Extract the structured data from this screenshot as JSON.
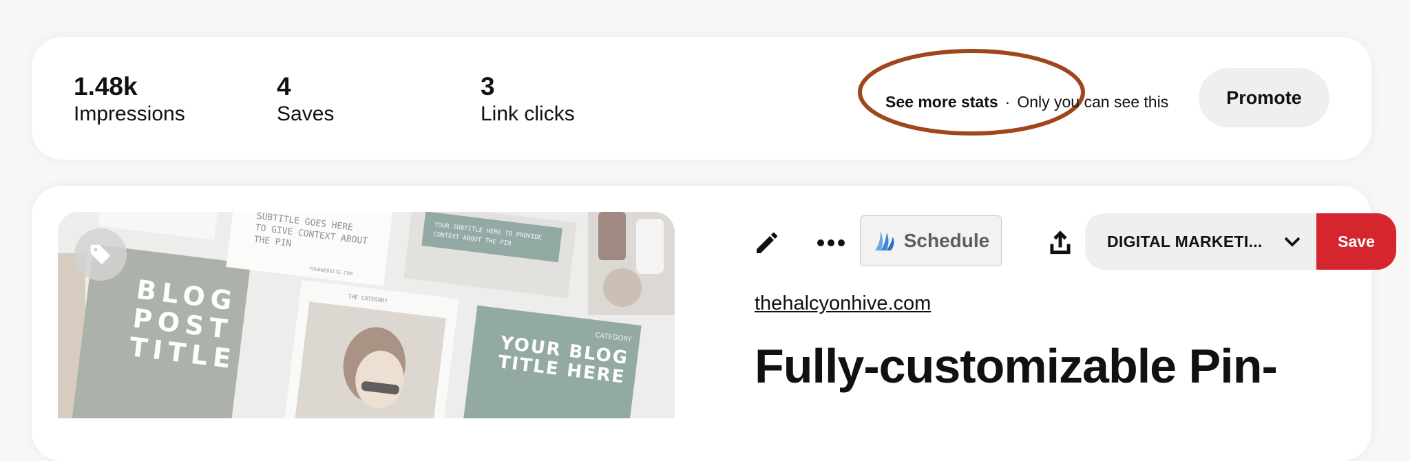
{
  "stats": [
    {
      "value": "1.48k",
      "label": "Impressions"
    },
    {
      "value": "4",
      "label": "Saves"
    },
    {
      "value": "3",
      "label": "Link clicks"
    }
  ],
  "more_stats": {
    "link": "See more stats",
    "separator": "·",
    "note": "Only you can see this"
  },
  "promote_label": "Promote",
  "toolbar": {
    "schedule_label": "Schedule",
    "board_name": "DIGITAL MARKETI...",
    "save_label": "Save",
    "icons": [
      "pencil-icon",
      "ellipsis-icon",
      "share-icon",
      "chevron-down-icon"
    ]
  },
  "pin": {
    "site": "thehalcyonhive.com",
    "title": "Fully-customizable Pin-",
    "image_text": {
      "blog_title": [
        "BLOG",
        "POST",
        "TITLE"
      ],
      "your_blog": [
        "YOUR BLOG",
        "TITLE HERE"
      ],
      "subtitle": [
        "SUBTITLE GOES HERE",
        "TO GIVE CONTEXT ABOUT",
        "THE PIN"
      ],
      "small_1": [
        "YOUR SUBTITLE HERE TO PROVIDE",
        "CONTEXT ABOUT THE PIN"
      ],
      "category": "CATEGORY",
      "the_category": "THE CATEGORY",
      "url": "YOURWEBSITE.COM"
    }
  },
  "colors": {
    "accent_save": "#d6262d",
    "annotation": "#a0461c",
    "teal_card": "#6a8880"
  }
}
